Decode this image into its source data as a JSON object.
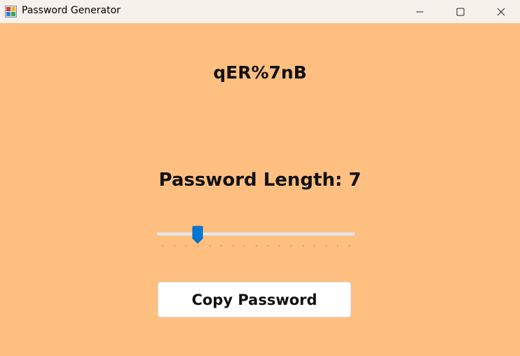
{
  "window": {
    "title": "Password Generator",
    "icon": "app-icon",
    "controls": [
      "minimize-icon",
      "maximize-icon",
      "close-icon"
    ]
  },
  "colors": {
    "background": "#ffbf80",
    "titlebar": "#f7f1ec",
    "accent": "#0078d4",
    "button": "#ffffff"
  },
  "generator": {
    "password": "qER%7nB",
    "length_label": "Password Length: ",
    "length_value": "7",
    "slider": {
      "min": 4,
      "max": 20,
      "value": 7
    },
    "copy_button_label": "Copy Password"
  }
}
